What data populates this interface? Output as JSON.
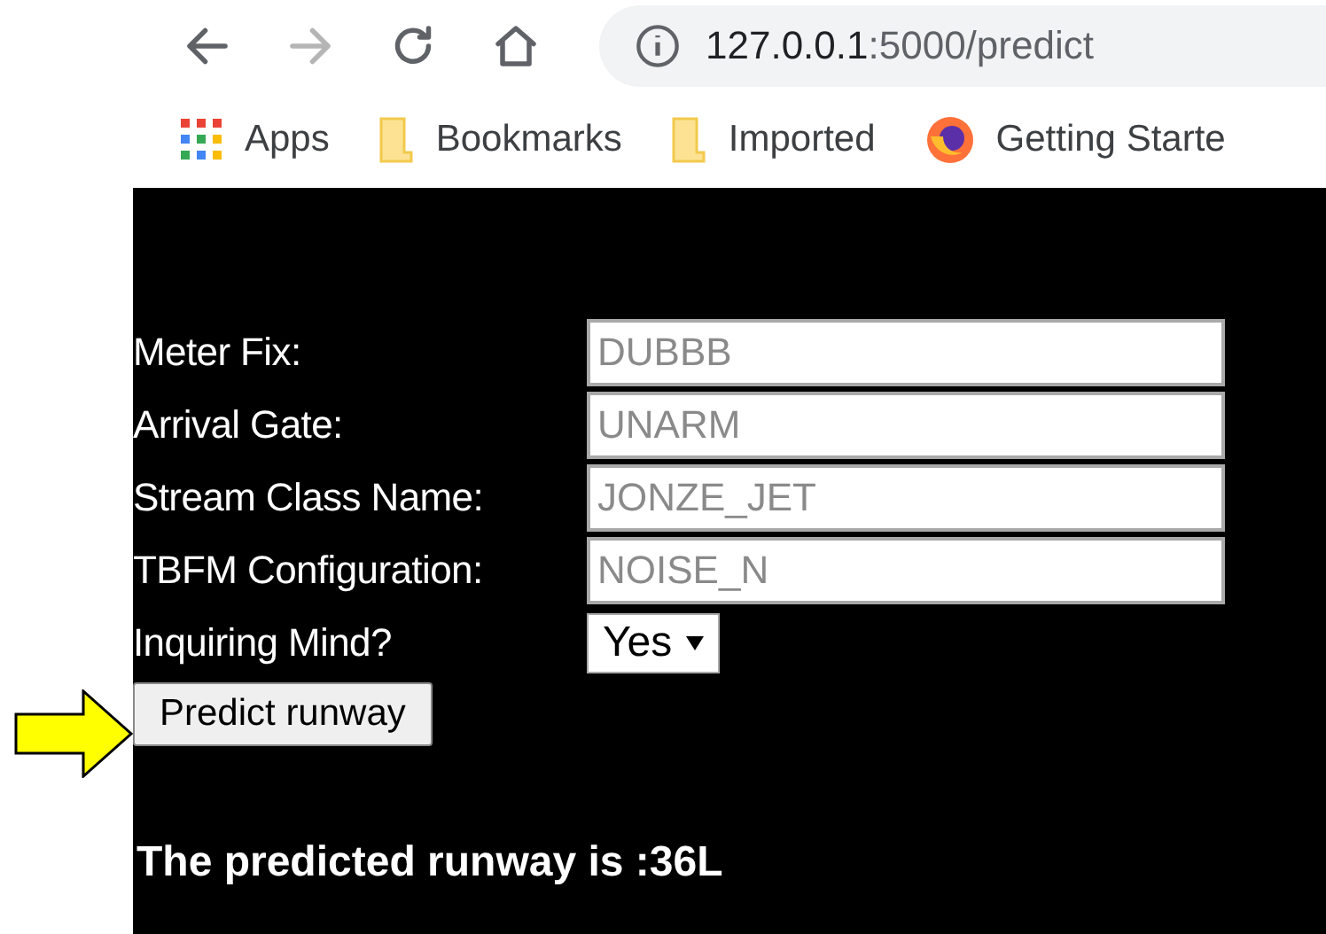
{
  "browser": {
    "url_host": "127.0.0.1",
    "url_path": ":5000/predict",
    "bookmarks": [
      {
        "kind": "apps",
        "label": "Apps"
      },
      {
        "kind": "folder",
        "label": "Bookmarks"
      },
      {
        "kind": "folder",
        "label": "Imported"
      },
      {
        "kind": "firefox",
        "label": "Getting Starte"
      }
    ]
  },
  "form": {
    "fields": [
      {
        "label": "Meter Fix:",
        "placeholder": "DUBBB"
      },
      {
        "label": "Arrival Gate:",
        "placeholder": "UNARM"
      },
      {
        "label": "Stream Class Name:",
        "placeholder": "JONZE_JET"
      },
      {
        "label": "TBFM Configuration:",
        "placeholder": "NOISE_N"
      }
    ],
    "select": {
      "label": "Inquiring Mind?",
      "value": "Yes"
    },
    "button": "Predict runway"
  },
  "result": "The predicted runway is :36L"
}
